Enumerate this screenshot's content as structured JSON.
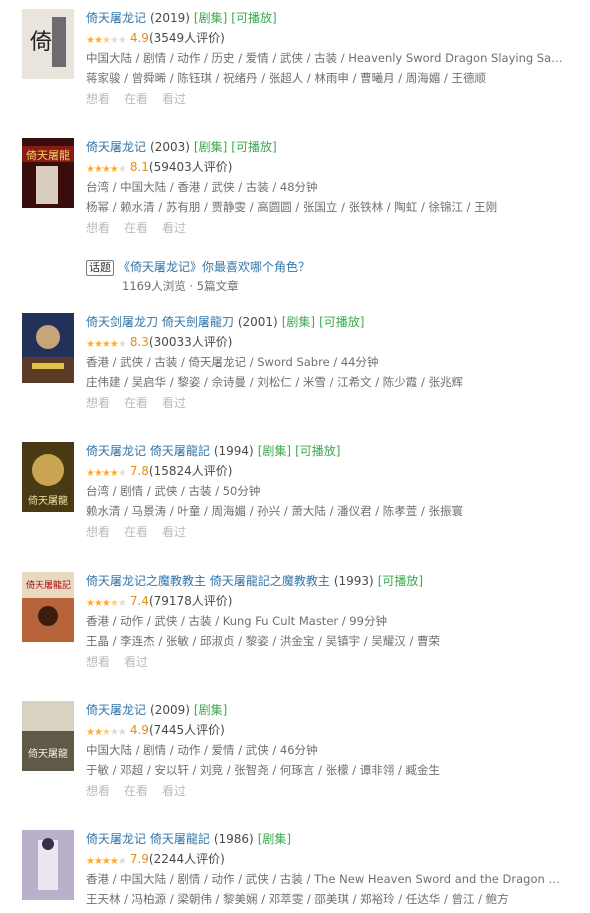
{
  "items": [
    {
      "title": "倚天屠龙记",
      "year": "(2019)",
      "tags": [
        "[剧集]",
        "[可播放]"
      ],
      "stars_filled": 2.5,
      "rating": "4.9",
      "count": "(3549人评价)",
      "meta": "中国大陆 / 剧情 / 动作 / 历史 / 爱情 / 武侠 / 古装 / Heavenly Sword Dragon Slaying Sab...",
      "cast": "蒋家骏 / 曾舜晞 / 陈钰琪 / 祝绪丹 / 张超人 / 林雨申 / 曹曦月 / 周海媚 / 王德顺",
      "actions": [
        "想看",
        "在看",
        "看过"
      ]
    },
    {
      "title": "倚天屠龙记",
      "year": "(2003)",
      "tags": [
        "[剧集]",
        "[可播放]"
      ],
      "stars_filled": 4,
      "rating": "8.1",
      "count": "(59403人评价)",
      "meta": "台湾 / 中国大陆 / 香港 / 武侠 / 古装 / 48分钟",
      "cast": "杨幂 / 赖水清 / 苏有朋 / 贾静雯 / 高圆圆 / 张国立 / 张铁林 / 陶虹 / 徐锦江 / 王刚",
      "actions": [
        "想看",
        "在看",
        "看过"
      ]
    },
    {
      "title": "倚天剑屠龙刀 倚天劍屠龍刀",
      "year": "(2001)",
      "tags": [
        "[剧集]",
        "[可播放]"
      ],
      "stars_filled": 4,
      "rating": "8.3",
      "count": "(30033人评价)",
      "meta": "香港 / 武侠 / 古装 / 倚天屠龙记 / Sword Sabre / 44分钟",
      "cast": "庄伟建 / 吴启华 / 黎姿 / 佘诗曼 / 刘松仁 / 米雪 / 江希文 / 陈少霞 / 张兆辉",
      "actions": [
        "想看",
        "在看",
        "看过"
      ]
    },
    {
      "title": "倚天屠龙记 倚天屠龍記",
      "year": "(1994)",
      "tags": [
        "[剧集]",
        "[可播放]"
      ],
      "stars_filled": 4,
      "rating": "7.8",
      "count": "(15824人评价)",
      "meta": "台湾 / 剧情 / 武侠 / 古装 / 50分钟",
      "cast": "赖水清 / 马景涛 / 叶童 / 周海媚 / 孙兴 / 萧大陆 / 潘仪君 / 陈孝萱 / 张振寰",
      "actions": [
        "想看",
        "在看",
        "看过"
      ]
    },
    {
      "title": "倚天屠龙记之魔教教主 倚天屠龍記之魔教教主",
      "year": "(1993)",
      "tags": [
        "[可播放]"
      ],
      "stars_filled": 3.5,
      "rating": "7.4",
      "count": "(79178人评价)",
      "meta": "香港 / 动作 / 武侠 / 古装 / Kung Fu Cult Master / 99分钟",
      "cast": "王晶 / 李连杰 / 张敏 / 邱淑贞 / 黎姿 / 洪金宝 / 吴镇宇 / 吴耀汉 / 曹荣",
      "actions": [
        "想看",
        "看过"
      ]
    },
    {
      "title": "倚天屠龙记",
      "year": "(2009)",
      "tags": [
        "[剧集]"
      ],
      "stars_filled": 2.5,
      "rating": "4.9",
      "count": "(7445人评价)",
      "meta": "中国大陆 / 剧情 / 动作 / 爱情 / 武侠 / 46分钟",
      "cast": "于敏 / 邓超 / 安以轩 / 刘竞 / 张智尧 / 何琢言 / 张檬 / 谭非翎 / 臧金生",
      "actions": [
        "想看",
        "在看",
        "看过"
      ]
    },
    {
      "title": "倚天屠龙记 倚天屠龍記",
      "year": "(1986)",
      "tags": [
        "[剧集]"
      ],
      "stars_filled": 4,
      "rating": "7.9",
      "count": "(2244人评价)",
      "meta": "香港 / 中国大陆 / 剧情 / 动作 / 武侠 / 古装 / The New Heaven Sword and the Dragon Sa...",
      "cast": "王天林 / 冯柏源 / 梁朝伟 / 黎美娴 / 邓萃雯 / 邵美琪 / 郑裕玲 / 任达华 / 曾江 / 鲍方",
      "actions": [
        "想看",
        "在看",
        "看过"
      ]
    }
  ],
  "topic": {
    "badge": "话题",
    "title": "《倚天屠龙记》你最喜欢哪个角色？",
    "views": "1169人浏览",
    "sep": " · ",
    "articles": "5篇文章"
  }
}
